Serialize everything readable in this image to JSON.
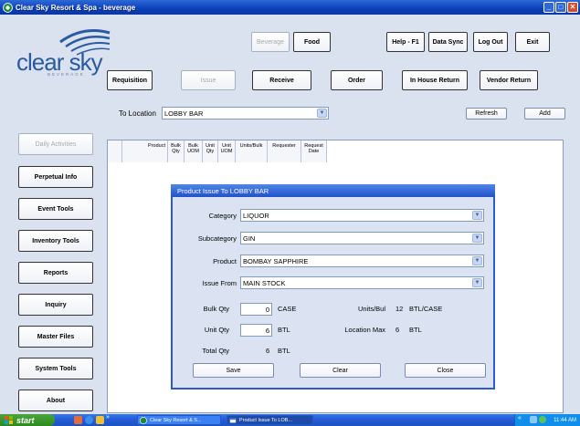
{
  "window": {
    "title": "Clear Sky Resort & Spa - beverage"
  },
  "logo": {
    "name": "clear sky",
    "sub": "BEVERAGE"
  },
  "top_buttons": {
    "beverage": "Beverage",
    "food": "Food",
    "help": "Help - F1",
    "data_sync": "Data Sync",
    "logout": "Log Out",
    "exit": "Exit"
  },
  "nav": {
    "requisition": "Requisition",
    "issue": "Issue",
    "receive": "Receive",
    "order": "Order",
    "in_house_return": "In House Return",
    "vendor_return": "Vendor Return"
  },
  "location": {
    "label": "To Location",
    "value": "LOBBY BAR",
    "refresh": "Refresh",
    "add": "Add"
  },
  "sidebar": {
    "items": [
      "Daily Activities",
      "Perpetual Info",
      "Event Tools",
      "Inventory Tools",
      "Reports",
      "Inquiry",
      "Master Files",
      "System Tools",
      "About"
    ]
  },
  "grid": {
    "columns": [
      "Product",
      "Bulk Qty",
      "Bulk UOM",
      "Unit Qty",
      "Unit UOM",
      "Units/Bulk",
      "Requester",
      "Request Date"
    ]
  },
  "dialog": {
    "title": "Product Issue To LOBBY BAR",
    "category_label": "Category",
    "category_value": "LIQUOR",
    "subcategory_label": "Subcategory",
    "subcategory_value": "GIN",
    "product_label": "Product",
    "product_value": "BOMBAY SAPPHIRE",
    "issue_from_label": "Issue From",
    "issue_from_value": "MAIN STOCK",
    "bulk_qty_label": "Bulk Qty",
    "bulk_qty_value": "0",
    "bulk_uom": "CASE",
    "units_bul_label": "Units/Bul",
    "units_bul_value": "12",
    "units_bul_uom": "BTL/CASE",
    "unit_qty_label": "Unit Qty",
    "unit_qty_value": "6",
    "unit_uom": "BTL",
    "location_max_label": "Location Max",
    "location_max_value": "6",
    "location_max_uom": "BTL",
    "total_qty_label": "Total Qty",
    "total_qty_value": "6",
    "total_qty_uom": "BTL",
    "save": "Save",
    "clear": "Clear",
    "close": "Close"
  },
  "taskbar": {
    "start": "start",
    "overflow": "»",
    "task1": "Clear Sky Resort & S...",
    "task2": "Product Issue To LOB...",
    "tray_arrow": "«",
    "clock": "11:44 AM"
  },
  "colors": {
    "titlebar": "#0a3fb8",
    "accent": "#2a5aa2",
    "client_bg": "#dbe2ef"
  }
}
